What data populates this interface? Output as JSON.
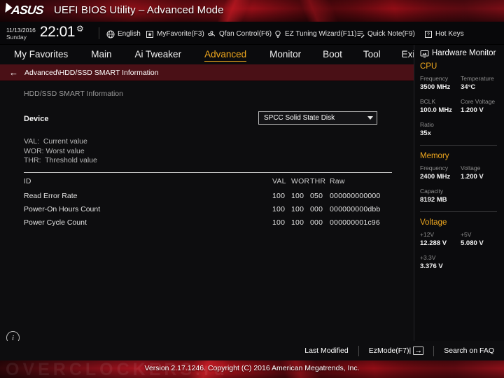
{
  "banner": {
    "logo": "ASUS",
    "title": "UEFI BIOS Utility – Advanced Mode"
  },
  "toolbar": {
    "date": "11/13/2016",
    "day": "Sunday",
    "time": "22:01",
    "gear_icon": "gear-icon",
    "items": [
      {
        "label": "English",
        "icon": "globe-icon"
      },
      {
        "label": "MyFavorite(F3)",
        "icon": "star-page-icon"
      },
      {
        "label": "Qfan Control(F6)",
        "icon": "fan-icon"
      },
      {
        "label": "EZ Tuning Wizard(F11)",
        "icon": "lightbulb-icon"
      },
      {
        "label": "Quick Note(F9)",
        "icon": "note-pencil-icon"
      },
      {
        "label": "Hot Keys",
        "icon": "question-key-icon"
      }
    ]
  },
  "tabs": {
    "items": [
      {
        "label": "My Favorites",
        "active": false
      },
      {
        "label": "Main",
        "active": false
      },
      {
        "label": "Ai Tweaker",
        "active": false
      },
      {
        "label": "Advanced",
        "active": true
      },
      {
        "label": "Monitor",
        "active": false
      },
      {
        "label": "Boot",
        "active": false
      },
      {
        "label": "Tool",
        "active": false
      },
      {
        "label": "Exit",
        "active": false
      }
    ]
  },
  "breadcrumb": {
    "back_icon": "back-arrow-icon",
    "path": "Advanced\\HDD/SSD SMART Information"
  },
  "main": {
    "section_title": "HDD/SSD SMART Information",
    "device_label": "Device",
    "device_value": "SPCC Solid State Disk",
    "legend": [
      "VAL:  Current value",
      "WOR: Worst value",
      "THR:  Threshold value"
    ],
    "table": {
      "headers": {
        "id": "ID",
        "val": "VAL",
        "wor": "WOR",
        "thr": "THR",
        "raw": "Raw"
      },
      "rows": [
        {
          "id": "Read Error Rate",
          "val": "100",
          "wor": "100",
          "thr": "050",
          "raw": "000000000000"
        },
        {
          "id": "Power-On Hours Count",
          "val": "100",
          "wor": "100",
          "thr": "000",
          "raw": "000000000dbb"
        },
        {
          "id": "Power Cycle Count",
          "val": "100",
          "wor": "100",
          "thr": "000",
          "raw": "000000001c96"
        }
      ]
    },
    "info_icon": "info-icon"
  },
  "sidebar": {
    "title": "Hardware Monitor",
    "title_icon": "monitor-icon",
    "sections": [
      {
        "name": "CPU",
        "fields": [
          {
            "key": "Frequency",
            "value": "3500 MHz",
            "wide": false
          },
          {
            "key": "Temperature",
            "value": "34°C",
            "wide": false
          },
          {
            "key": "BCLK",
            "value": "100.0 MHz",
            "wide": false
          },
          {
            "key": "Core Voltage",
            "value": "1.200 V",
            "wide": false
          },
          {
            "key": "Ratio",
            "value": "35x",
            "wide": true
          }
        ]
      },
      {
        "name": "Memory",
        "fields": [
          {
            "key": "Frequency",
            "value": "2400 MHz",
            "wide": false
          },
          {
            "key": "Voltage",
            "value": "1.200 V",
            "wide": false
          },
          {
            "key": "Capacity",
            "value": "8192 MB",
            "wide": true
          }
        ]
      },
      {
        "name": "Voltage",
        "fields": [
          {
            "key": "+12V",
            "value": "12.288 V",
            "wide": false
          },
          {
            "key": "+5V",
            "value": "5.080 V",
            "wide": false
          },
          {
            "key": "+3.3V",
            "value": "3.376 V",
            "wide": true
          }
        ]
      }
    ]
  },
  "bottombar": {
    "last_modified": "Last Modified",
    "ezmode": "EzMode(F7)|",
    "ezmode_icon": "arrow-into-bracket-icon",
    "search_faq": "Search on FAQ"
  },
  "footer": {
    "watermark": "OVERCLOCKERS.ru",
    "version": "Version 2.17.1246. Copyright (C) 2016 American Megatrends, Inc."
  },
  "colors": {
    "accent_gold": "#f0a81e",
    "brand_red": "#a81420",
    "crumb_red": "#4a1016"
  }
}
